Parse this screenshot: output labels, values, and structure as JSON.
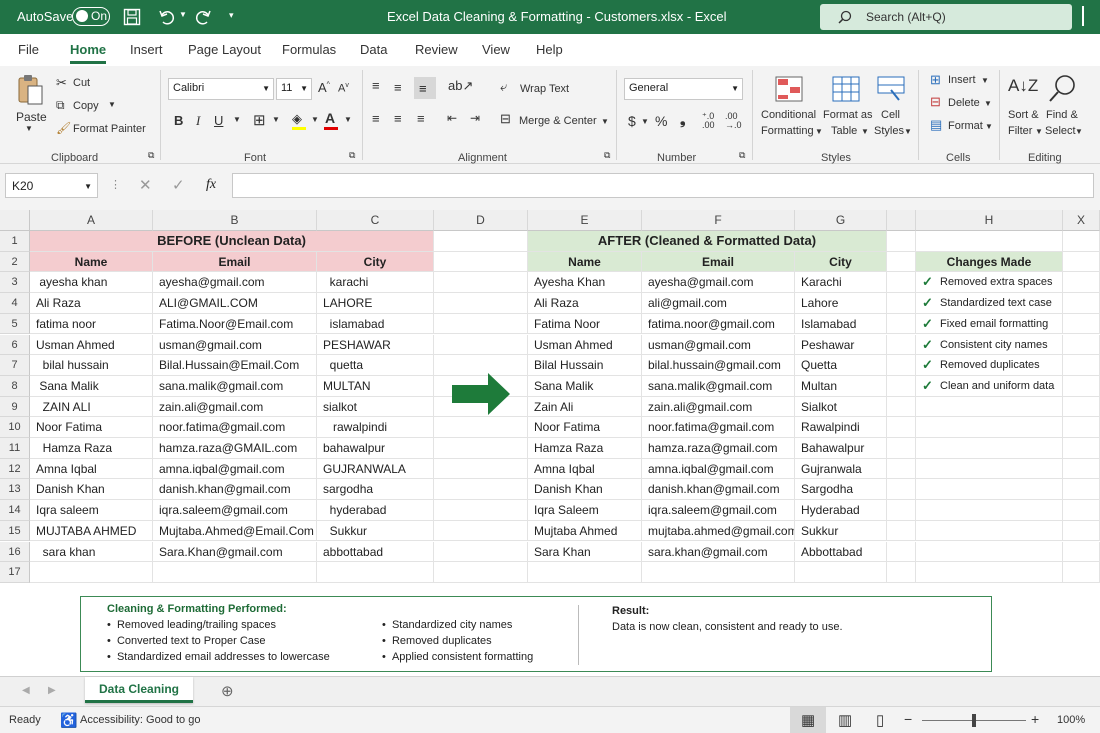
{
  "title_bar": {
    "autosave_label": "AutoSave",
    "autosave_state": "On",
    "document_title": "Excel Data Cleaning & Formatting - Customers.xlsx - Excel",
    "search_placeholder": "Search (Alt+Q)"
  },
  "ribbon_tabs": [
    "File",
    "Home",
    "Insert",
    "Page Layout",
    "Formulas",
    "Data",
    "Review",
    "View",
    "Help"
  ],
  "active_tab": "Home",
  "ribbon": {
    "clipboard": {
      "paste": "Paste",
      "cut": "Cut",
      "copy": "Copy",
      "format_painter": "Format Painter",
      "group": "Clipboard"
    },
    "font": {
      "family": "Calibri",
      "size": "11",
      "group": "Font"
    },
    "alignment": {
      "wrap_text": "Wrap Text",
      "merge_center": "Merge & Center",
      "group": "Alignment"
    },
    "number": {
      "format": "General",
      "group": "Number"
    },
    "styles": {
      "conditional_1": "Conditional",
      "conditional_2": "Formatting",
      "format_as_1": "Format as",
      "format_as_2": "Table",
      "cell_1": "Cell",
      "cell_2": "Styles",
      "group": "Styles"
    },
    "cells": {
      "insert": "Insert",
      "delete": "Delete",
      "format": "Format",
      "group": "Cells"
    },
    "editing": {
      "sort_1": "Sort &",
      "sort_2": "Filter",
      "find_1": "Find &",
      "find_2": "Select",
      "group": "Editing"
    }
  },
  "formula_bar": {
    "name_box": "K20",
    "formula": ""
  },
  "columns": [
    "A",
    "B",
    "C",
    "D",
    "E",
    "F",
    "G",
    "H",
    "X"
  ],
  "rows": [
    "1",
    "2",
    "3",
    "4",
    "5",
    "6",
    "7",
    "8",
    "9",
    "10",
    "11",
    "12",
    "13",
    "14",
    "15",
    "16",
    "17"
  ],
  "before": {
    "title": "BEFORE (Unclean Data)",
    "headers": [
      "Name",
      "Email",
      "City"
    ],
    "data": [
      [
        " ayesha khan",
        "ayesha@gmail.com",
        "  karachi"
      ],
      [
        "Ali Raza",
        "ALI@GMAIL.COM",
        "LAHORE"
      ],
      [
        "fatima noor",
        "Fatima.Noor@Email.com",
        "  islamabad"
      ],
      [
        "Usman Ahmed",
        "usman@gmail.com",
        "PESHAWAR"
      ],
      [
        "  bilal hussain",
        "Bilal.Hussain@Email.Com",
        "  quetta"
      ],
      [
        " Sana Malik",
        "sana.malik@gmail.com",
        "MULTAN"
      ],
      [
        "  ZAIN ALI",
        "zain.ali@gmail.com",
        "sialkot"
      ],
      [
        "Noor Fatima",
        "noor.fatima@gmail.com",
        "   rawalpindi"
      ],
      [
        "  Hamza Raza",
        "hamza.raza@GMAIL.com",
        "bahawalpur"
      ],
      [
        "Amna Iqbal",
        "amna.iqbal@gmail.com",
        "GUJRANWALA"
      ],
      [
        "Danish Khan",
        "danish.khan@gmail.com",
        "sargodha"
      ],
      [
        "Iqra saleem",
        "iqra.saleem@gmail.com",
        "  hyderabad"
      ],
      [
        "MUJTABA AHMED",
        "Mujtaba.Ahmed@Email.Com",
        "  Sukkur"
      ],
      [
        "  sara khan",
        "Sara.Khan@gmail.com",
        "abbottabad"
      ]
    ]
  },
  "after": {
    "title": "AFTER (Cleaned & Formatted Data)",
    "headers": [
      "Name",
      "Email",
      "City"
    ],
    "data": [
      [
        "Ayesha Khan",
        "ayesha@gmail.com",
        "Karachi"
      ],
      [
        "Ali Raza",
        "ali@gmail.com",
        "Lahore"
      ],
      [
        "Fatima Noor",
        "fatima.noor@gmail.com",
        "Islamabad"
      ],
      [
        "Usman Ahmed",
        "usman@gmail.com",
        "Peshawar"
      ],
      [
        "Bilal Hussain",
        "bilal.hussain@gmail.com",
        "Quetta"
      ],
      [
        "Sana Malik",
        "sana.malik@gmail.com",
        "Multan"
      ],
      [
        "Zain Ali",
        "zain.ali@gmail.com",
        "Sialkot"
      ],
      [
        "Noor Fatima",
        "noor.fatima@gmail.com",
        "Rawalpindi"
      ],
      [
        "Hamza Raza",
        "hamza.raza@gmail.com",
        "Bahawalpur"
      ],
      [
        "Amna Iqbal",
        "amna.iqbal@gmail.com",
        "Gujranwala"
      ],
      [
        "Danish Khan",
        "danish.khan@gmail.com",
        "Sargodha"
      ],
      [
        "Iqra Saleem",
        "iqra.saleem@gmail.com",
        "Hyderabad"
      ],
      [
        "Mujtaba Ahmed",
        "mujtaba.ahmed@gmail.com",
        "Sukkur"
      ],
      [
        "Sara Khan",
        "sara.khan@gmail.com",
        "Abbottabad"
      ]
    ]
  },
  "changes": {
    "title": "Changes Made",
    "items": [
      "Removed extra spaces",
      "Standardized text case",
      "Fixed email formatting",
      "Consistent city names",
      "Removed duplicates",
      "Clean and uniform data"
    ]
  },
  "summary": {
    "title": "Cleaning & Formatting Performed:",
    "left_items": [
      "Removed leading/trailing spaces",
      "Converted text to Proper Case",
      "Standardized email addresses to lowercase"
    ],
    "right_items": [
      "Standardized city names",
      "Removed duplicates",
      "Applied consistent formatting"
    ],
    "result_title": "Result:",
    "result_text": "Data is now clean, consistent and ready to use."
  },
  "sheet_tab": "Data Cleaning",
  "status": {
    "ready": "Ready",
    "accessibility": "Accessibility: Good to go",
    "zoom": "100%",
    "zoom_level": 1.0
  },
  "colors": {
    "excel_green": "#217346",
    "before_fill": "#f4cccf",
    "after_fill": "#d9ead3",
    "arrow": "#1e7b3a",
    "check": "#1e7b3a"
  }
}
